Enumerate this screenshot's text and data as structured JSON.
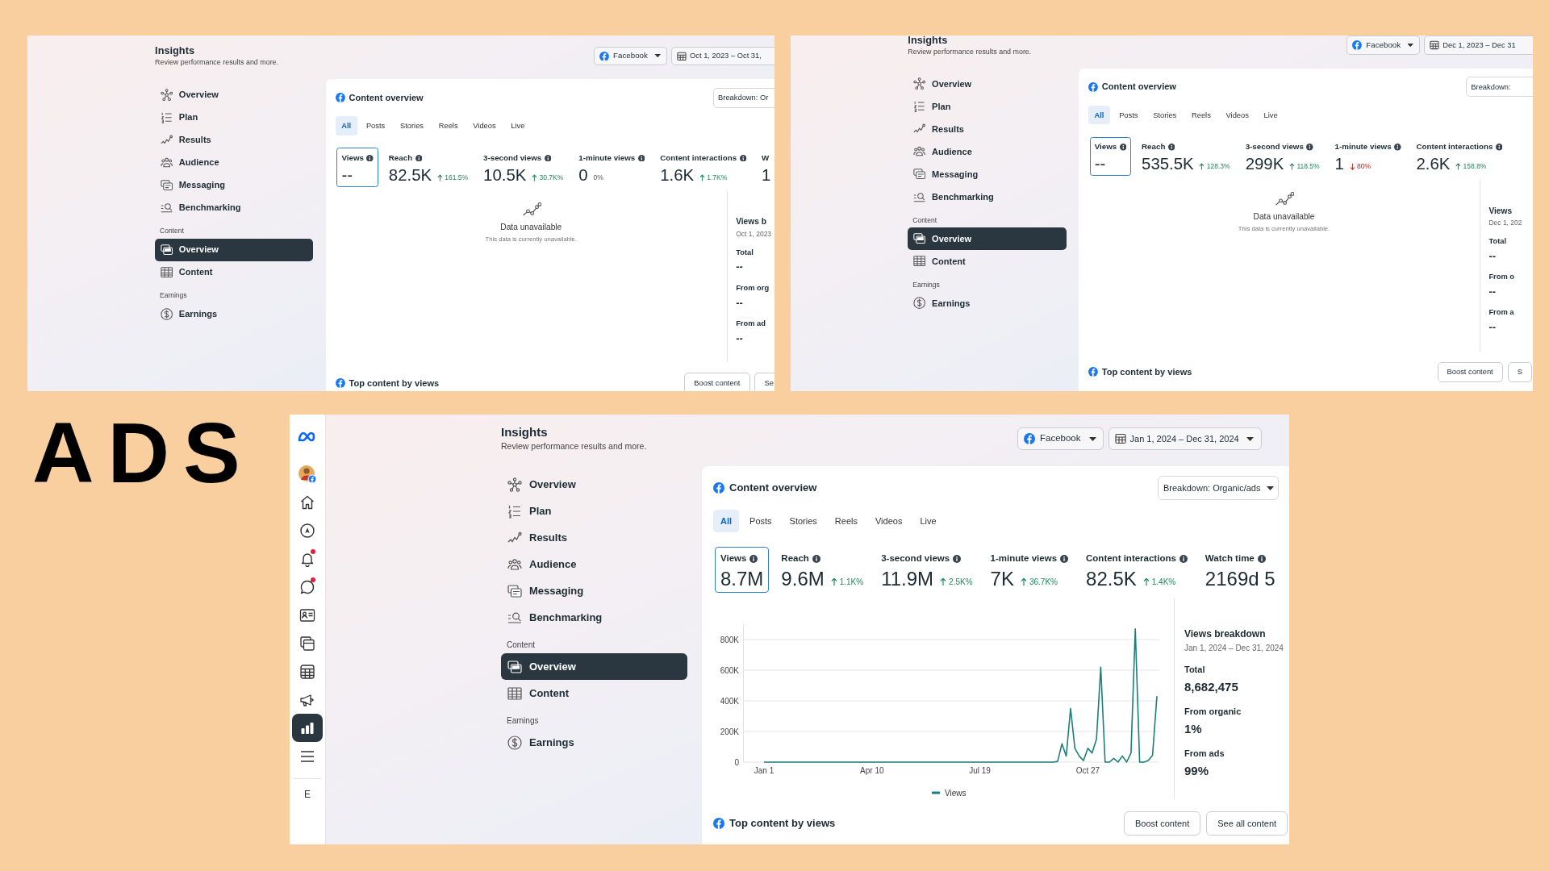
{
  "heading": "ADS",
  "panels": [
    {
      "header": {
        "title": "Insights",
        "subtitle": "Review performance results and more."
      },
      "platform_dropdown": {
        "label": "Facebook"
      },
      "date_dropdown": {
        "label": "Oct 1, 2023 – Oct 31,"
      },
      "nav": [
        {
          "items": [
            {
              "label": "Overview",
              "selected": false
            },
            {
              "label": "Plan",
              "selected": false
            },
            {
              "label": "Results",
              "selected": false
            },
            {
              "label": "Audience",
              "selected": false
            },
            {
              "label": "Messaging",
              "selected": false
            },
            {
              "label": "Benchmarking",
              "selected": false
            }
          ]
        },
        {
          "heading": "Content",
          "items": [
            {
              "label": "Overview",
              "selected": true
            },
            {
              "label": "Content",
              "selected": false
            }
          ]
        },
        {
          "heading": "Earnings",
          "items": [
            {
              "label": "Earnings",
              "selected": false
            }
          ]
        }
      ],
      "card": {
        "title": "Content overview",
        "breakdown_dropdown": {
          "label": "Breakdown: Or"
        },
        "tabs": [
          {
            "label": "All",
            "selected": true
          },
          {
            "label": "Posts",
            "selected": false
          },
          {
            "label": "Stories",
            "selected": false
          },
          {
            "label": "Reels",
            "selected": false
          },
          {
            "label": "Videos",
            "selected": false
          },
          {
            "label": "Live",
            "selected": false
          }
        ],
        "metrics": [
          {
            "label": "Views",
            "info": true,
            "value": "--",
            "selected": true
          },
          {
            "label": "Reach",
            "info": true,
            "value": "82.5K",
            "change": "161.5%",
            "rising": true,
            "selected": false
          },
          {
            "label": "3-second views",
            "info": true,
            "value": "10.5K",
            "change": "30.7K%",
            "rising": true,
            "selected": false
          },
          {
            "label": "1-minute views",
            "info": true,
            "value": "0",
            "change": "0%",
            "selected": false
          },
          {
            "label": "Content interactions",
            "info": true,
            "value": "1.6K",
            "change": "1.7K%",
            "rising": true,
            "selected": false
          },
          {
            "label": "W",
            "info": false,
            "value": "1",
            "selected": false
          }
        ],
        "body": {
          "kind": "unavailable",
          "title": "Data unavailable",
          "text": "This data is currently unavailable."
        },
        "breakdown": {
          "title": "Views b",
          "date": "Oct 1, 2023",
          "rows": [
            {
              "label": "Total",
              "value": "--"
            },
            {
              "label": "From org",
              "value": "--"
            },
            {
              "label": "From ad",
              "value": "--"
            }
          ]
        },
        "footer": {
          "title": "Top content by views",
          "buttons": [
            "Boost content",
            "Se"
          ]
        }
      }
    },
    {
      "header": {
        "title": "Insights",
        "subtitle": "Review performance results and more."
      },
      "platform_dropdown": {
        "label": "Facebook"
      },
      "date_dropdown": {
        "label": "Dec 1, 2023 – Dec 31"
      },
      "nav": [
        {
          "items": [
            {
              "label": "Overview",
              "selected": false
            },
            {
              "label": "Plan",
              "selected": false
            },
            {
              "label": "Results",
              "selected": false
            },
            {
              "label": "Audience",
              "selected": false
            },
            {
              "label": "Messaging",
              "selected": false
            },
            {
              "label": "Benchmarking",
              "selected": false
            }
          ]
        },
        {
          "heading": "Content",
          "items": [
            {
              "label": "Overview",
              "selected": true
            },
            {
              "label": "Content",
              "selected": false
            }
          ]
        },
        {
          "heading": "Earnings",
          "items": [
            {
              "label": "Earnings",
              "selected": false
            }
          ]
        }
      ],
      "card": {
        "title": "Content overview",
        "breakdown_dropdown": {
          "label": "Breakdown:"
        },
        "tabs": [
          {
            "label": "All",
            "selected": true
          },
          {
            "label": "Posts",
            "selected": false
          },
          {
            "label": "Stories",
            "selected": false
          },
          {
            "label": "Reels",
            "selected": false
          },
          {
            "label": "Videos",
            "selected": false
          },
          {
            "label": "Live",
            "selected": false
          }
        ],
        "metrics": [
          {
            "label": "Views",
            "info": true,
            "value": "--",
            "selected": true
          },
          {
            "label": "Reach",
            "info": true,
            "value": "535.5K",
            "change": "128.3%",
            "rising": true,
            "selected": false
          },
          {
            "label": "3-second views",
            "info": true,
            "value": "299K",
            "change": "118.5%",
            "rising": true,
            "selected": false
          },
          {
            "label": "1-minute views",
            "info": true,
            "value": "1",
            "change": "80%",
            "rising": false,
            "selected": false
          },
          {
            "label": "Content interactions",
            "info": true,
            "value": "2.6K",
            "change": "158.8%",
            "rising": true,
            "selected": false
          }
        ],
        "body": {
          "kind": "unavailable",
          "title": "Data unavailable",
          "text": "This data is currently unavailable."
        },
        "breakdown": {
          "title": "Views",
          "date": "Dec 1, 202",
          "rows": [
            {
              "label": "Total",
              "value": "--"
            },
            {
              "label": "From o",
              "value": "--"
            },
            {
              "label": "From a",
              "value": "--"
            }
          ]
        },
        "footer": {
          "title": "Top content by views",
          "buttons": [
            "Boost content",
            "S"
          ]
        }
      }
    },
    {
      "rail": {
        "items": [
          {
            "selected": false,
            "badge": false
          },
          {
            "selected": false,
            "badge": false
          },
          {
            "selected": false,
            "badge": false
          },
          {
            "selected": false,
            "badge": false
          },
          {
            "selected": false,
            "badge": true
          },
          {
            "selected": false,
            "badge": true
          },
          {
            "selected": false,
            "badge": false
          },
          {
            "selected": false,
            "badge": false
          },
          {
            "selected": false,
            "badge": false
          },
          {
            "selected": false,
            "badge": false
          },
          {
            "selected": true,
            "badge": false
          },
          {
            "selected": false,
            "badge": false
          }
        ],
        "label": "E"
      },
      "header": {
        "title": "Insights",
        "subtitle": "Review performance results and more."
      },
      "platform_dropdown": {
        "label": "Facebook"
      },
      "date_dropdown": {
        "label": "Jan 1, 2024 – Dec 31, 2024"
      },
      "nav": [
        {
          "items": [
            {
              "label": "Overview",
              "selected": false
            },
            {
              "label": "Plan",
              "selected": false
            },
            {
              "label": "Results",
              "selected": false
            },
            {
              "label": "Audience",
              "selected": false
            },
            {
              "label": "Messaging",
              "selected": false
            },
            {
              "label": "Benchmarking",
              "selected": false
            }
          ]
        },
        {
          "heading": "Content",
          "items": [
            {
              "label": "Overview",
              "selected": true
            },
            {
              "label": "Content",
              "selected": false
            }
          ]
        },
        {
          "heading": "Earnings",
          "items": [
            {
              "label": "Earnings",
              "selected": false
            }
          ]
        }
      ],
      "card": {
        "title": "Content overview",
        "breakdown_dropdown": {
          "label": "Breakdown: Organic/ads"
        },
        "tabs": [
          {
            "label": "All",
            "selected": true
          },
          {
            "label": "Posts",
            "selected": false
          },
          {
            "label": "Stories",
            "selected": false
          },
          {
            "label": "Reels",
            "selected": false
          },
          {
            "label": "Videos",
            "selected": false
          },
          {
            "label": "Live",
            "selected": false
          }
        ],
        "metrics": [
          {
            "label": "Views",
            "info": true,
            "value": "8.7M",
            "selected": true
          },
          {
            "label": "Reach",
            "info": true,
            "value": "9.6M",
            "change": "1.1K%",
            "rising": true,
            "selected": false
          },
          {
            "label": "3-second views",
            "info": true,
            "value": "11.9M",
            "change": "2.5K%",
            "rising": true,
            "selected": false
          },
          {
            "label": "1-minute views",
            "info": true,
            "value": "7K",
            "change": "36.7K%",
            "rising": true,
            "selected": false
          },
          {
            "label": "Content interactions",
            "info": true,
            "value": "82.5K",
            "change": "1.4K%",
            "rising": true,
            "selected": false
          },
          {
            "label": "Watch time",
            "info": true,
            "value": "2169d 5",
            "selected": false
          }
        ],
        "body": {
          "kind": "chart",
          "chart_data": {
            "type": "line",
            "grid": true,
            "ylim": [
              0,
              900000
            ],
            "categories": [
              "Jan 1",
              null,
              null,
              null,
              null,
              null,
              null,
              null,
              null,
              null,
              null,
              null,
              null,
              null,
              null,
              null,
              null,
              null,
              null,
              null,
              null,
              null,
              null,
              null,
              null,
              "Apr 10",
              null,
              null,
              null,
              null,
              null,
              null,
              null,
              null,
              null,
              null,
              null,
              null,
              null,
              null,
              null,
              null,
              null,
              null,
              null,
              null,
              null,
              null,
              null,
              null,
              "Jul 19",
              null,
              null,
              null,
              null,
              null,
              null,
              null,
              null,
              null,
              null,
              null,
              null,
              null,
              null,
              null,
              null,
              null,
              null,
              null,
              null,
              null,
              null,
              null,
              null,
              "Oct 27",
              null,
              null,
              null,
              null,
              null,
              null,
              null,
              null,
              null,
              null,
              null,
              null,
              null,
              null,
              null,
              null
            ],
            "yticks": [
              {
                "value": 0,
                "label": "0"
              },
              {
                "value": 200000,
                "label": "200K"
              },
              {
                "value": 400000,
                "label": "400K"
              },
              {
                "value": 600000,
                "label": "600K"
              },
              {
                "value": 800000,
                "label": "800K"
              }
            ],
            "series": [
              {
                "name": "Views",
                "color": "#1b7f79",
                "values": [
                  0,
                  0,
                  0,
                  0,
                  0,
                  0,
                  0,
                  0,
                  0,
                  0,
                  0,
                  0,
                  0,
                  0,
                  0,
                  0,
                  0,
                  0,
                  0,
                  0,
                  0,
                  0,
                  0,
                  0,
                  0,
                  0,
                  0,
                  0,
                  0,
                  0,
                  0,
                  0,
                  0,
                  0,
                  0,
                  0,
                  0,
                  0,
                  0,
                  0,
                  0,
                  0,
                  0,
                  0,
                  0,
                  0,
                  0,
                  0,
                  0,
                  0,
                  0,
                  0,
                  0,
                  0,
                  0,
                  0,
                  0,
                  0,
                  0,
                  0,
                  0,
                  0,
                  0,
                  0,
                  0,
                  0,
                  0,
                  0,
                  5000,
                  120000,
                  40000,
                  350000,
                  90000,
                  40000,
                  10000,
                  90000,
                  60000,
                  150000,
                  620000,
                  0,
                  0,
                  25000,
                  0,
                  40000,
                  0,
                  60000,
                  870000,
                  0,
                  0,
                  10000,
                  45000,
                  430000
                ]
              }
            ]
          }
        },
        "breakdown": {
          "title": "Views breakdown",
          "date": "Jan 1, 2024 – Dec 31, 2024",
          "rows": [
            {
              "label": "Total",
              "value": "8,682,475"
            },
            {
              "label": "From organic",
              "value": "1%"
            },
            {
              "label": "From ads",
              "value": "99%"
            }
          ]
        },
        "footer": {
          "title": "Top content by views",
          "buttons": [
            "Boost content",
            "See all content"
          ]
        }
      }
    }
  ]
}
